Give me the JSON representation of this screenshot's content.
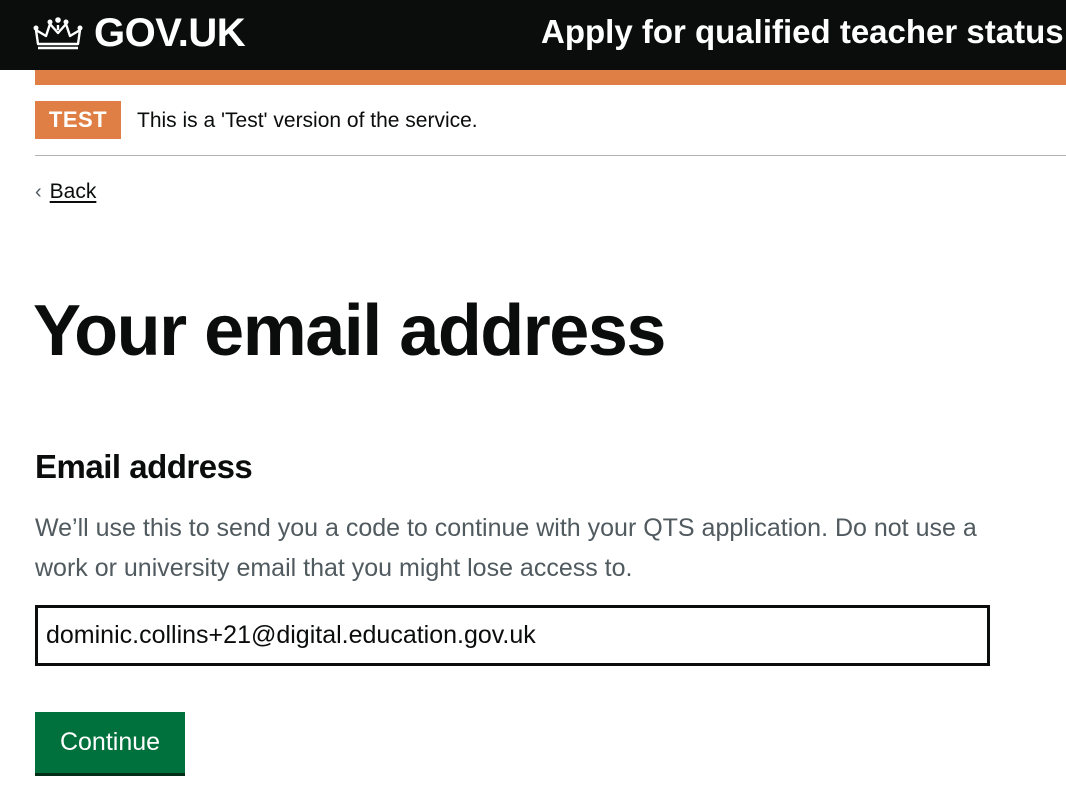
{
  "header": {
    "logo_text": "GOV.UK",
    "logo_icon": "crown-icon",
    "service_name": "Apply for qualified teacher status"
  },
  "phase_banner": {
    "tag": "TEST",
    "text": "This is a 'Test' version of the service.",
    "tag_color": "#e07f45"
  },
  "back": {
    "icon": "chevron-left-icon",
    "chevron": "‹",
    "label": "Back"
  },
  "page": {
    "title": "Your email address"
  },
  "email_field": {
    "label": "Email address",
    "hint": "We’ll use this to send you a code to continue with your QTS application. Do not use a work or university email that you might lose access to.",
    "value": "dominic.collins+21@digital.education.gov.uk"
  },
  "actions": {
    "continue_label": "Continue",
    "continue_color": "#00703c"
  }
}
